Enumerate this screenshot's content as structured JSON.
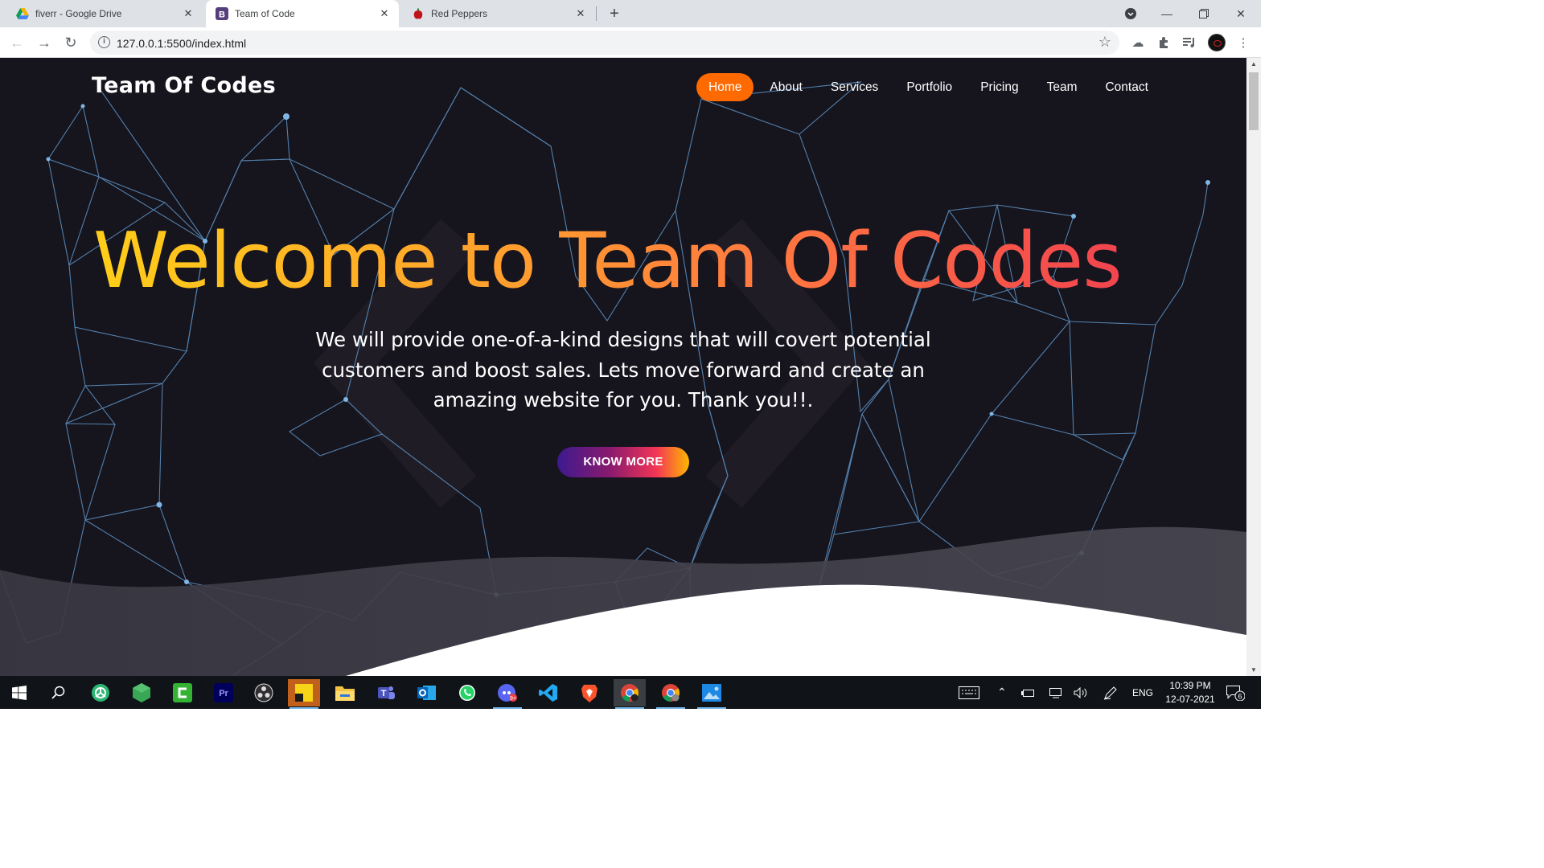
{
  "browser": {
    "tabs": [
      {
        "title": "fiverr - Google Drive",
        "icon": "google-drive-icon",
        "active": false
      },
      {
        "title": "Team of Code",
        "icon": "bootstrap-icon",
        "active": true
      },
      {
        "title": "Red Peppers",
        "icon": "pepper-icon",
        "active": false
      }
    ],
    "url": "127.0.0.1:5500/index.html"
  },
  "site": {
    "brand": "Team Of Codes",
    "nav": [
      "Home",
      "About",
      "Services",
      "Portfolio",
      "Pricing",
      "Team",
      "Contact"
    ],
    "active_nav": "Home",
    "hero_title": "Welcome to Team Of Codes",
    "hero_subtitle_lines": [
      "We will provide one-of-a-kind designs that will covert potential",
      "customers and boost sales. Lets move forward and create an",
      "amazing website for you. Thank you!!."
    ],
    "cta": "KNOW MORE",
    "colors": {
      "accent": "#ff6a00",
      "background": "#16141d",
      "network": "#6aa6d9"
    }
  },
  "taskbar": {
    "apps": [
      "windows-start",
      "search",
      "app-green-circle",
      "app-hexagon",
      "camtasia",
      "premiere-pro",
      "obs",
      "sticky-notes",
      "file-explorer",
      "teams",
      "outlook",
      "whatsapp",
      "discord",
      "vscode",
      "brave",
      "chrome",
      "chrome-2",
      "photos"
    ],
    "tray": {
      "lang": "ENG",
      "time": "10:39 PM",
      "date": "12-07-2021",
      "notifications": "6"
    }
  }
}
